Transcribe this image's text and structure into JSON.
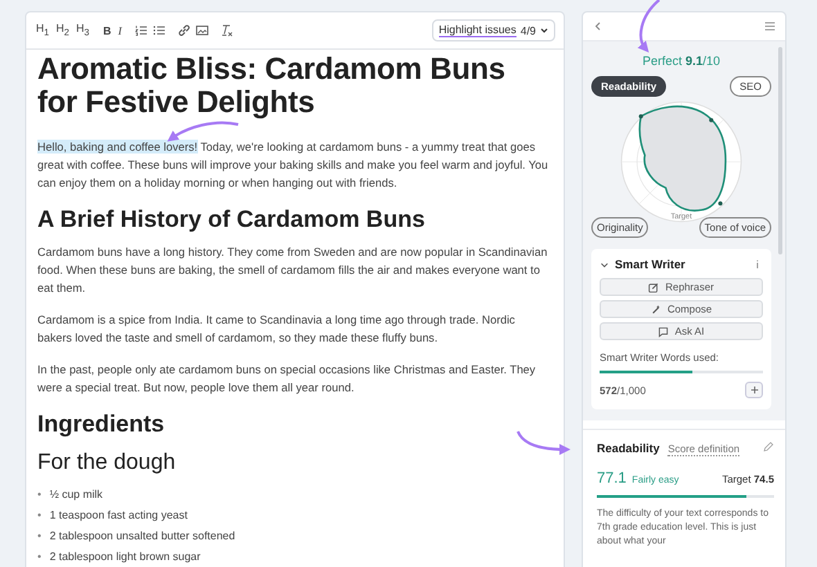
{
  "editor": {
    "toolbar": {
      "heading_buttons": [
        "H$_{1}$",
        "H$_{2}$",
        "H$_{3}$"
      ],
      "format_buttons": [
        "B",
        "I"
      ],
      "highlight": {
        "label": "Highlight issues",
        "count": "4/9"
      }
    },
    "title": "Aromatic Bliss: Cardamom Buns for Festive Delights",
    "blocks": [
      {
        "kind": "paragraph",
        "highlighted": "Hello, baking and coffee lovers!",
        "text": " Today, we're looking at cardamom buns - a yummy treat that goes great with coffee. These buns will improve your baking skills and make you feel warm and joyful. You can enjoy them on a holiday morning or when hanging out with friends."
      },
      {
        "kind": "h2",
        "text": "A Brief History of Cardamom Buns"
      },
      {
        "kind": "paragraph",
        "text": "Cardamom buns have a long history. They come from Sweden and are now popular in Scandinavian food. When these buns are baking, the smell of cardamom fills the air and makes everyone want to eat them."
      },
      {
        "kind": "paragraph",
        "text": "Cardamom is a spice from India. It came to Scandinavia a long time ago through trade. Nordic bakers loved the taste and smell of cardamom, so they made these fluffy buns."
      },
      {
        "kind": "paragraph",
        "text": "In the past, people only ate cardamom buns on special occasions like Christmas and Easter. They were a special treat. But now, people love them all year round."
      },
      {
        "kind": "h2",
        "text": "Ingredients"
      },
      {
        "kind": "h3",
        "text": "For the dough"
      },
      {
        "kind": "list",
        "bullet": "•",
        "items": [
          "½ cup milk",
          "1 teaspoon fast acting yeast",
          "2 tablespoon unsalted butter softened",
          "2 tablespoon light brown sugar"
        ]
      }
    ]
  },
  "score_panel": {
    "score": "Perfect **9.1**/10",
    "tabs": [
      {
        "label": "Readability",
        "selected": true
      },
      {
        "label": "SEO",
        "selected": false
      }
    ],
    "radar": {
      "target_label": "Target",
      "axes": [
        "Originality",
        "Tone of voice"
      ]
    }
  },
  "smart_writer": {
    "title": "Smart Writer",
    "expanded": true,
    "actions": [
      "Rephraser",
      "Compose",
      "Ask AI"
    ],
    "usage_label": "Smart Writer Words used:",
    "level": 0.572,
    "usage": "**572**/1,000"
  },
  "readability": {
    "title": "Readability",
    "link": "Score definition",
    "score": "77.1",
    "rating": "Fairly easy",
    "target": "Target **74.5**",
    "level": 0.84,
    "description": "The difficulty of your text corresponds to 7th grade education level. This is just about what your"
  }
}
